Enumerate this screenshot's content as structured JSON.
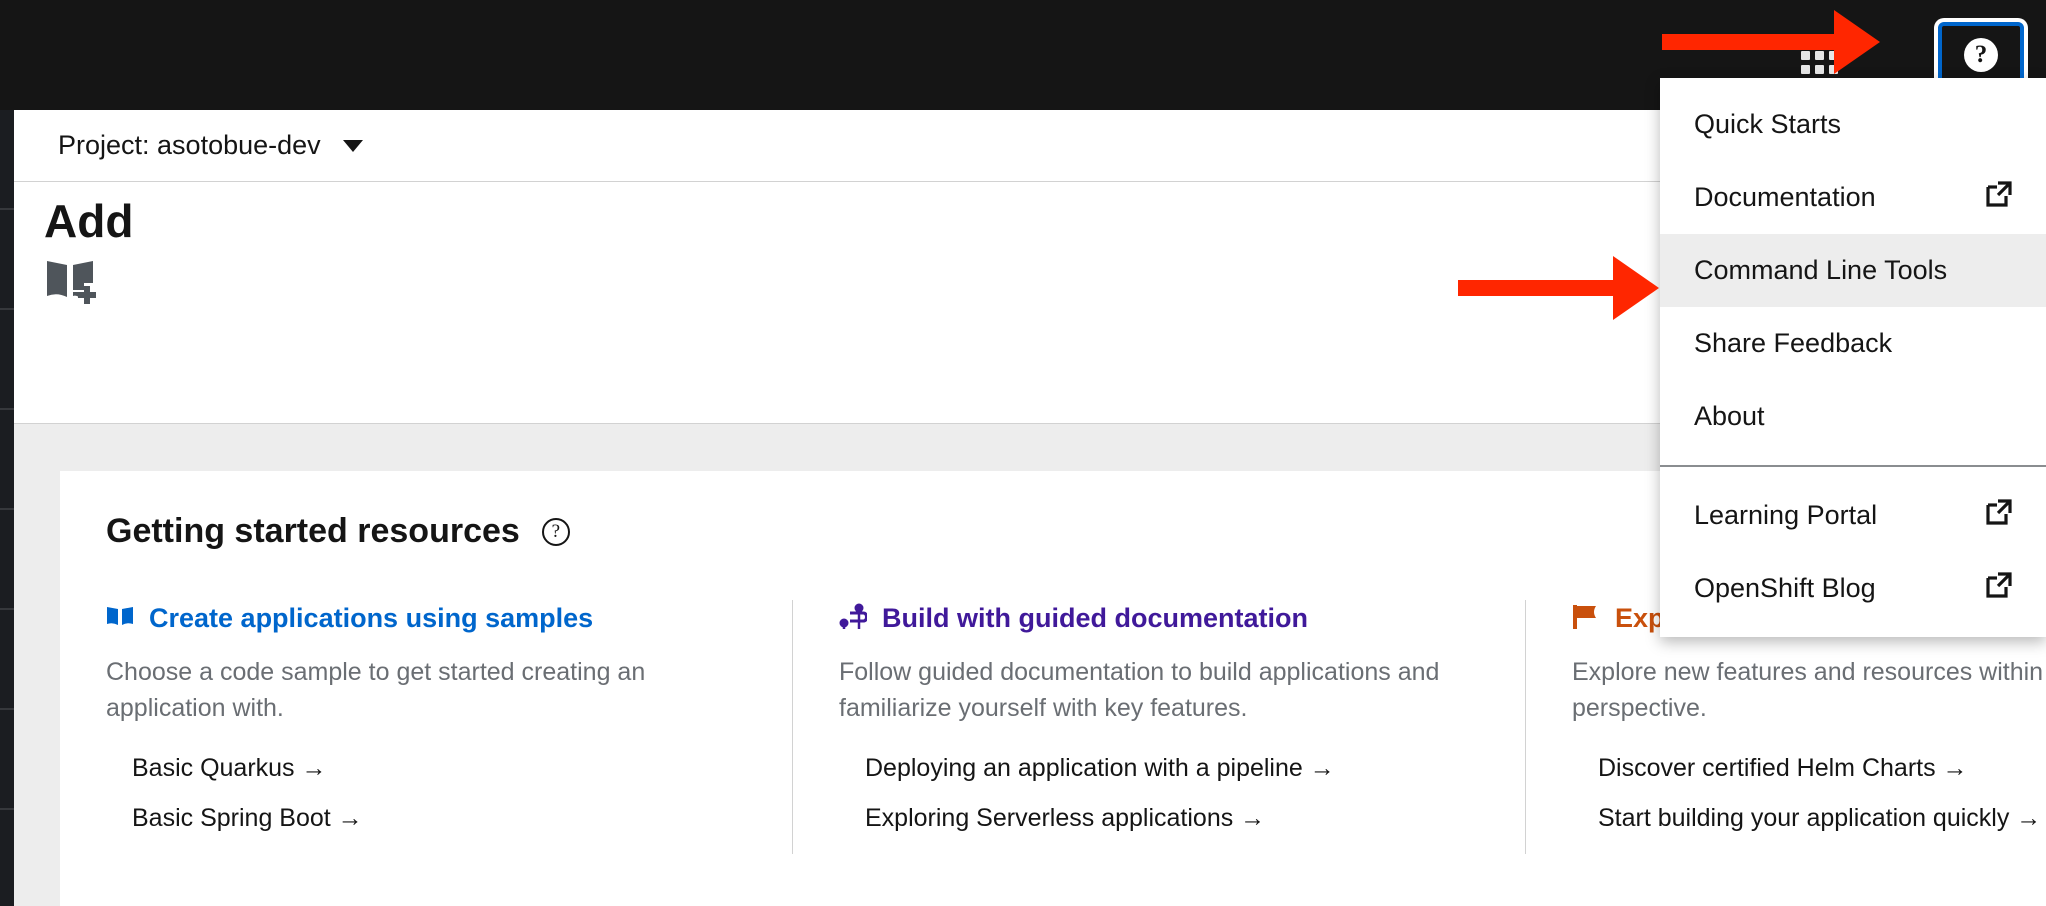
{
  "masthead": {
    "apps_icon_name": "apps-grid-icon",
    "help_button_label": "?",
    "help_button_title": "Help"
  },
  "project_bar": {
    "project_label": "Project: asotobue-dev",
    "caret_icon": "chevron-down-icon"
  },
  "page": {
    "title": "Add",
    "book_icon": "book-plus-icon"
  },
  "help_menu": {
    "groups": [
      {
        "items": [
          {
            "label": "Quick Starts",
            "external": false,
            "active": false
          },
          {
            "label": "Documentation",
            "external": true,
            "active": false
          },
          {
            "label": "Command Line Tools",
            "external": false,
            "active": true
          },
          {
            "label": "Share Feedback",
            "external": false,
            "active": false
          },
          {
            "label": "About",
            "external": false,
            "active": false
          }
        ]
      },
      {
        "items": [
          {
            "label": "Learning Portal",
            "external": true,
            "active": false
          },
          {
            "label": "OpenShift Blog",
            "external": true,
            "active": false
          }
        ]
      }
    ],
    "external_icon": "external-link-icon"
  },
  "getting_started": {
    "title": "Getting started resources",
    "help_icon": "help-circle-icon",
    "columns": [
      {
        "icon": "book-icon",
        "color": "#0066cc",
        "title": "Create applications using samples",
        "description": "Choose a code sample to get started creating an application with.",
        "links": [
          "Basic Quarkus →",
          "Basic Spring Boot →"
        ]
      },
      {
        "icon": "route-icon",
        "color": "#40199a",
        "title": "Build with guided documentation",
        "description": "Follow guided documentation to build applications and familiarize yourself with key features.",
        "links": [
          "Deploying an application with a pipeline →",
          "Exploring Serverless applications →"
        ]
      },
      {
        "icon": "flag-icon",
        "color": "#c9500c",
        "title": "Explore new features and resources",
        "description": "Explore new features and resources within the developer perspective.",
        "links": [
          "Discover certified Helm Charts →",
          "Start building your application quickly →"
        ]
      }
    ]
  },
  "annotations": {
    "arrow_color": "#ff2600",
    "arrow_top_target": "apps-grid-icon",
    "arrow_menu_target": "Command Line Tools"
  },
  "colors": {
    "masthead_bg": "#151515",
    "focus_outline": "#0066cc",
    "body_bg": "#ededed",
    "card_bg": "#ffffff",
    "text": "#151515",
    "muted_text": "#6a6e73"
  }
}
